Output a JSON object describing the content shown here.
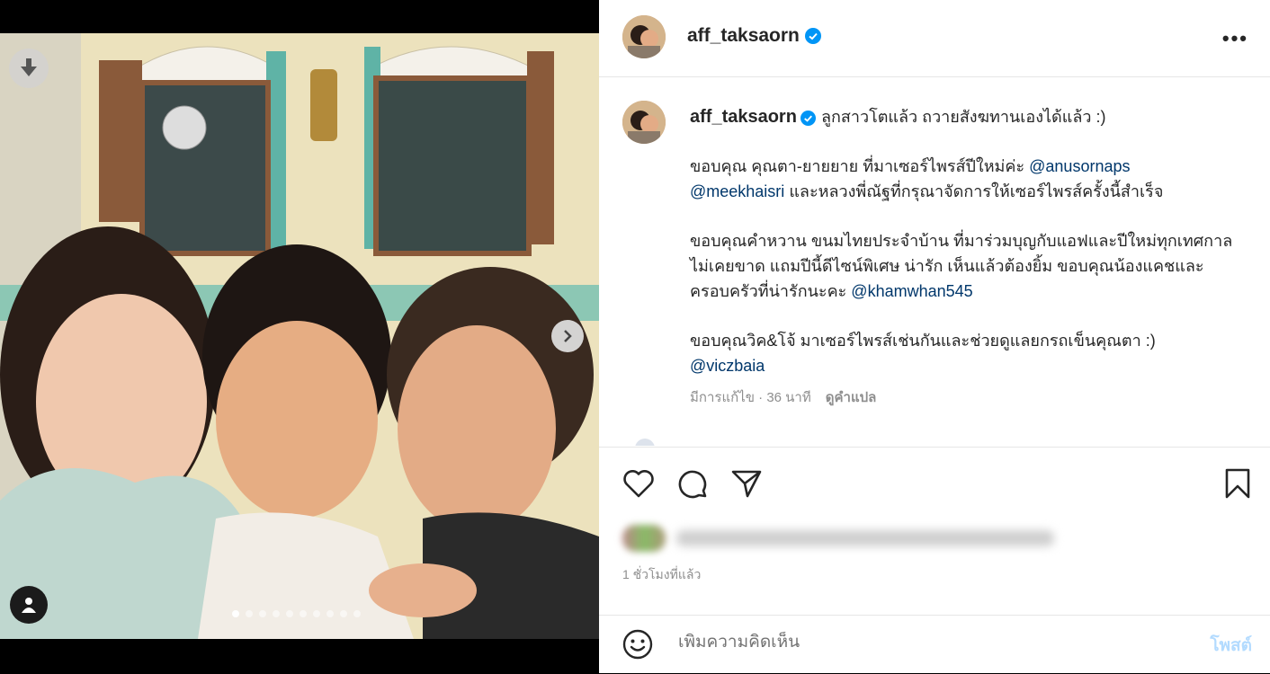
{
  "post": {
    "username": "aff_taksaorn",
    "verified": true,
    "more_label": "•••"
  },
  "caption": {
    "line1": "ลูกสาวโตแล้ว ถวายสังฆทานเองได้แล้ว :)",
    "para1_text": "ขอบคุณ คุณตา-ยายยาย ที่มาเซอร์ไพรส์ปีใหม่ค่ะ ",
    "para1_mention1": "@anusornaps",
    "para1_mention2": "@meekhaisri",
    "para1_text2": " และหลวงพี่ณัฐที่กรุณาจัดการให้เซอร์ไพรส์ครั้งนี้สำเร็จ",
    "para2_text": "ขอบคุณคำหวาน ขนมไทยประจำบ้าน ที่มาร่วมบุญกับแอฟและปีใหม่ทุกเทศกาลไม่เคยขาด แถมปีนี้ดีไซน์พิเศษ น่ารัก เห็นแล้วต้องยิ้ม ขอบคุณน้องแคชและครอบครัวที่น่ารักนะคะ ",
    "para2_mention": "@khamwhan545",
    "para3_text": "ขอบคุณวิค&โจ้ มาเซอร์ไพรส์เช่นกันและช่วยดูแลยกรถเข็นคุณตา :)",
    "para3_mention": "@viczbaia",
    "edited_label": "มีการแก้ไข · 36 นาที",
    "translate_label": "ดูคำแปล"
  },
  "engagement": {
    "time_ago": "1 ชั่วโมงที่แล้ว"
  },
  "comment_box": {
    "placeholder": "เพิ่มความคิดเห็น",
    "post_label": "โพสต์"
  },
  "carousel": {
    "total": 10,
    "active_index": 0
  },
  "colors": {
    "mention": "#00376b",
    "verified": "#0095f6",
    "post_button": "#b3dbff"
  },
  "icons": [
    "download-icon",
    "chevron-right-icon",
    "user-tag-icon",
    "heart-icon",
    "comment-icon",
    "share-icon",
    "bookmark-icon",
    "emoji-icon",
    "verified-icon",
    "more-icon"
  ]
}
